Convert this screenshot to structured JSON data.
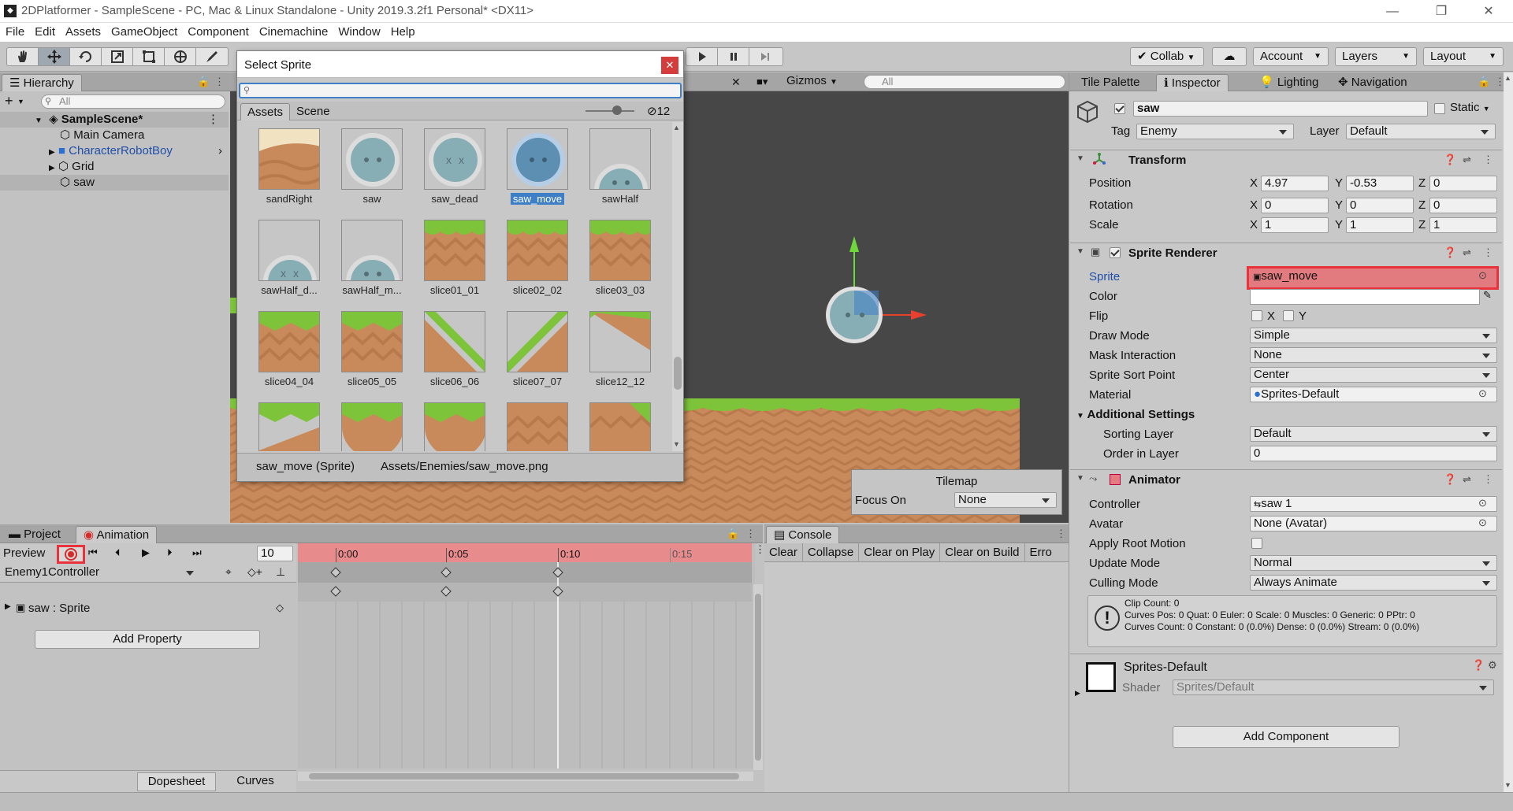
{
  "window": {
    "title": "2DPlatformer - SampleScene - PC, Mac & Linux Standalone - Unity 2019.3.2f1 Personal* <DX11>",
    "logo": "unity-logo-icon",
    "buttons": {
      "minimize": "—",
      "restore": "❐",
      "close": "✕"
    }
  },
  "menu": [
    "File",
    "Edit",
    "Assets",
    "GameObject",
    "Component",
    "Cinemachine",
    "Window",
    "Help"
  ],
  "toolbar": {
    "tools": [
      "hand-tool-icon",
      "move-tool-icon",
      "rotate-tool-icon",
      "scale-tool-icon",
      "rect-tool-icon",
      "transform-tool-icon",
      "custom-tool-icon"
    ],
    "collab": "Collab",
    "account": "Account",
    "layers": "Layers",
    "layout": "Layout"
  },
  "hierarchy": {
    "tab": "Hierarchy",
    "create": "+",
    "search_placeholder": "All",
    "scene": "SampleScene*",
    "items": [
      {
        "label": "Main Camera",
        "color": "#111111"
      },
      {
        "label": "CharacterRobotBoy",
        "color": "#1f4fa8"
      },
      {
        "label": "Grid",
        "color": "#111111"
      },
      {
        "label": "saw",
        "color": "#111111"
      }
    ]
  },
  "scene_view": {
    "gizmos": "Gizmos",
    "search_placeholder": "All",
    "tilemap": {
      "title": "Tilemap",
      "focus_label": "Focus On",
      "focus_value": "None"
    }
  },
  "select_sprite": {
    "title": "Select Sprite",
    "tabs": [
      "Assets",
      "Scene"
    ],
    "hidden_count": "12",
    "items": [
      {
        "label": "sandRight"
      },
      {
        "label": "saw"
      },
      {
        "label": "saw_dead"
      },
      {
        "label": "saw_move",
        "selected": true
      },
      {
        "label": "sawHalf"
      },
      {
        "label": "sawHalf_d..."
      },
      {
        "label": "sawHalf_m..."
      },
      {
        "label": "slice01_01"
      },
      {
        "label": "slice02_02"
      },
      {
        "label": "slice03_03"
      },
      {
        "label": "slice04_04"
      },
      {
        "label": "slice05_05"
      },
      {
        "label": "slice06_06"
      },
      {
        "label": "slice07_07"
      },
      {
        "label": "slice12_12"
      },
      {
        "label": ""
      },
      {
        "label": ""
      },
      {
        "label": ""
      },
      {
        "label": ""
      },
      {
        "label": ""
      }
    ],
    "footer_name": "saw_move (Sprite)",
    "footer_path": "Assets/Enemies/saw_move.png"
  },
  "animation": {
    "tabs": [
      "Project",
      "Animation"
    ],
    "preview": "Preview",
    "frame": "10",
    "controller": "Enemy1Controller",
    "timeline": [
      "0:00",
      "0:05",
      "0:10",
      "0:15"
    ],
    "property": "saw : Sprite",
    "add_property": "Add Property",
    "bottom_tabs": [
      "Dopesheet",
      "Curves"
    ]
  },
  "console": {
    "tab": "Console",
    "buttons": [
      "Clear",
      "Collapse",
      "Clear on Play",
      "Clear on Build",
      "Erro"
    ]
  },
  "inspector": {
    "tabs": [
      "Tile Palette",
      "Inspector",
      "Lighting",
      "Navigation"
    ],
    "object_name": "saw",
    "static": "Static",
    "tag_label": "Tag",
    "tag": "Enemy",
    "layer_label": "Layer",
    "layer": "Default",
    "transform": {
      "title": "Transform",
      "rows": [
        {
          "label": "Position",
          "x": "4.97",
          "y": "-0.53",
          "z": "0"
        },
        {
          "label": "Rotation",
          "x": "0",
          "y": "0",
          "z": "0"
        },
        {
          "label": "Scale",
          "x": "1",
          "y": "1",
          "z": "1"
        }
      ]
    },
    "sprite_renderer": {
      "title": "Sprite Renderer",
      "sprite_label": "Sprite",
      "sprite": "saw_move",
      "color_label": "Color",
      "flip_label": "Flip",
      "flip_x": "X",
      "flip_y": "Y",
      "draw_mode_label": "Draw Mode",
      "draw_mode": "Simple",
      "mask_label": "Mask Interaction",
      "mask": "None",
      "sort_point_label": "Sprite Sort Point",
      "sort_point": "Center",
      "material_label": "Material",
      "material": "Sprites-Default",
      "additional": "Additional Settings",
      "sorting_layer_label": "Sorting Layer",
      "sorting_layer": "Default",
      "order_label": "Order in Layer",
      "order": "0"
    },
    "animator": {
      "title": "Animator",
      "controller_label": "Controller",
      "controller": "saw 1",
      "avatar_label": "Avatar",
      "avatar": "None (Avatar)",
      "root_motion_label": "Apply Root Motion",
      "update_label": "Update Mode",
      "update": "Normal",
      "culling_label": "Culling Mode",
      "culling": "Always Animate",
      "info1": "Clip Count: 0",
      "info2": "Curves Pos: 0 Quat: 0 Euler: 0 Scale: 0 Muscles: 0 Generic: 0 PPtr: 0",
      "info3": "Curves Count: 0 Constant: 0 (0.0%) Dense: 0 (0.0%) Stream: 0 (0.0%)"
    },
    "material": {
      "name": "Sprites-Default",
      "shader_label": "Shader",
      "shader": "Sprites/Default"
    },
    "add_component": "Add Component"
  },
  "colors": {
    "accent": "#e8323c",
    "selection": "#3e7fc6",
    "link": "#1f4fa8",
    "timeline_record": "#e88b8d"
  }
}
